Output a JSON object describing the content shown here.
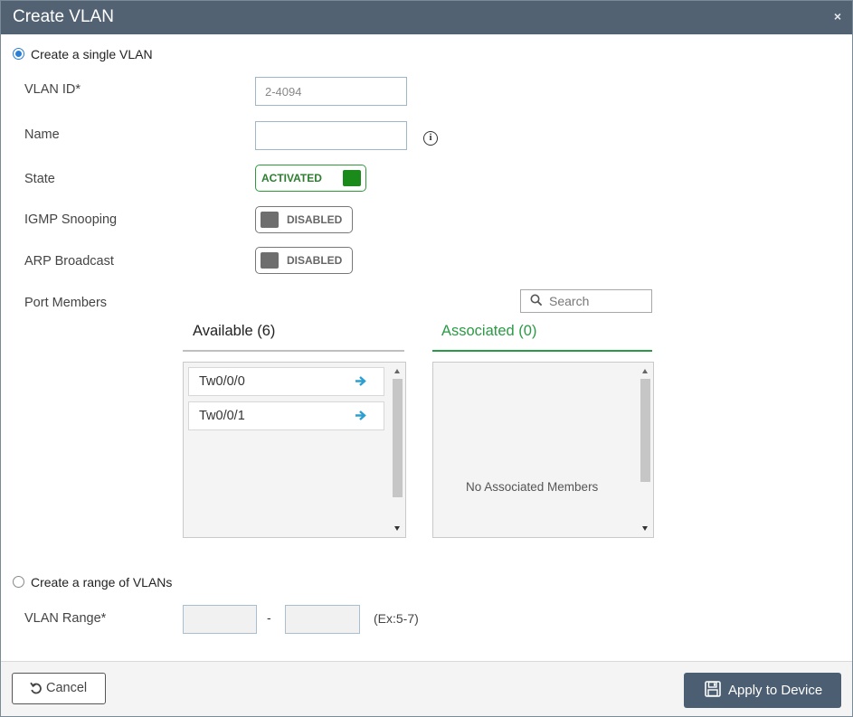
{
  "dialog": {
    "title": "Create VLAN",
    "close_glyph": "×"
  },
  "single": {
    "radio_label": "Create a single VLAN",
    "selected": true,
    "vlan_id": {
      "label": "VLAN ID*",
      "placeholder": "2-4094",
      "value": ""
    },
    "name": {
      "label": "Name",
      "value": "",
      "info_icon": "info-icon"
    },
    "state": {
      "label": "State",
      "value": "ACTIVATED",
      "on": true
    },
    "igmp": {
      "label": "IGMP Snooping",
      "value": "DISABLED",
      "on": false
    },
    "arp": {
      "label": "ARP Broadcast",
      "value": "DISABLED",
      "on": false
    },
    "port_members": {
      "label": "Port Members",
      "search_placeholder": "Search",
      "available": {
        "title": "Available (6)",
        "items": [
          {
            "name": "Tw0/0/0"
          },
          {
            "name": "Tw0/0/1"
          }
        ]
      },
      "associated": {
        "title": "Associated (0)",
        "empty_text": "No Associated Members"
      }
    }
  },
  "range": {
    "radio_label": "Create a range of VLANs",
    "selected": false,
    "label": "VLAN Range*",
    "from": "",
    "to": "",
    "separator": "-",
    "hint": "(Ex:5-7)"
  },
  "footer": {
    "cancel_label": "Cancel",
    "apply_label": "Apply to Device"
  },
  "colors": {
    "titlebar": "#526273",
    "accent_green": "#2a9a44",
    "radio_blue": "#2a7fd4",
    "apply_button": "#4c5f72",
    "arrow_blue": "#2a9fd0"
  }
}
